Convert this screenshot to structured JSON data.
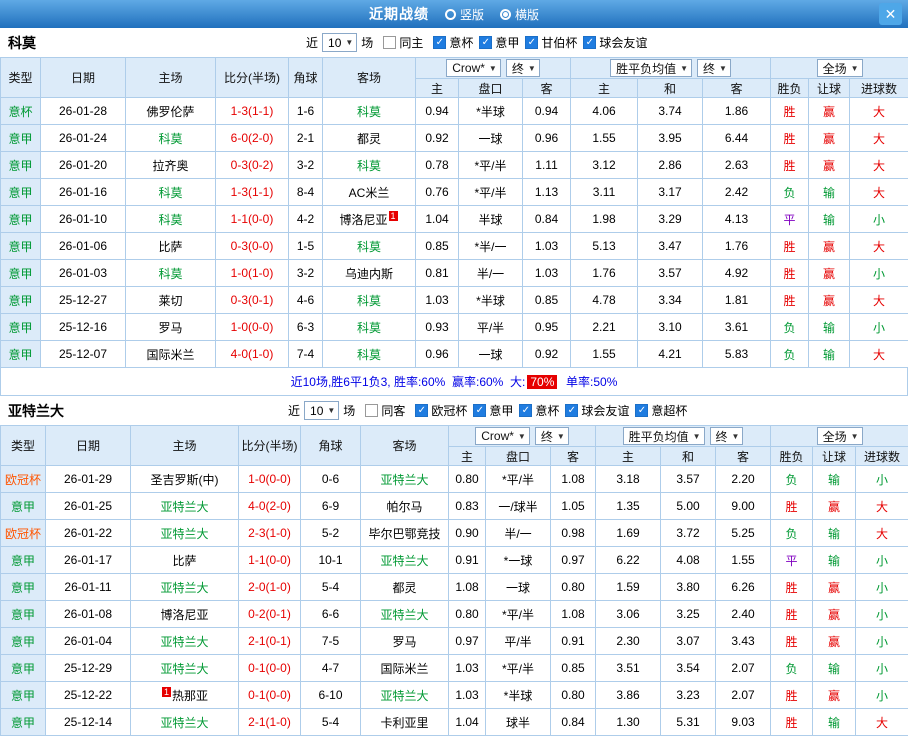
{
  "titlebar": {
    "title": "近期战绩",
    "radios": [
      {
        "label": "竖版",
        "selected": false
      },
      {
        "label": "横版",
        "selected": true
      }
    ],
    "close_label": "✕"
  },
  "colors": {
    "bar_blue_top": "#5fa9e5",
    "bar_blue_bottom": "#2070bd",
    "header_bg": "#dcebf9",
    "grid_line": "#aecdea",
    "win_red": "#e60000",
    "lose_green": "#009933",
    "draw_purple": "#8000c0",
    "league_orange": "#ff5500",
    "summary_blue": "#0000e6",
    "checkbox_blue": "#1f7ce0"
  },
  "value_colors": {
    "胜": "red",
    "平": "purple",
    "负": "green",
    "赢": "red",
    "输": "green",
    "大": "red",
    "小": "green"
  },
  "league_colors": {
    "意杯": "green",
    "意甲": "green",
    "欧冠杯": "orange",
    "甘伯杯": "green",
    "意超杯": "green"
  },
  "table_headers": {
    "type": "类型",
    "date": "日期",
    "home": "主场",
    "score": "比分(半场)",
    "corner": "角球",
    "away": "客场",
    "odds_home": "主",
    "handicap": "盘口",
    "odds_away": "客",
    "avg_home": "主",
    "avg_draw": "和",
    "avg_away": "客",
    "result_wdl": "胜负",
    "result_handicap": "让球",
    "result_goals": "进球数",
    "company_select": "Crow*",
    "final_select": "终",
    "avg_select": "胜平负均值",
    "scope_select": "全场"
  },
  "sections": [
    {
      "team": "科莫",
      "filters": {
        "near": "近",
        "count": "10",
        "unit": "场",
        "venue": {
          "label": "同主",
          "checked": false
        },
        "leagues": [
          {
            "label": "意杯",
            "checked": true
          },
          {
            "label": "意甲",
            "checked": true
          },
          {
            "label": "甘伯杯",
            "checked": true
          },
          {
            "label": "球会友谊",
            "checked": true
          }
        ]
      },
      "rows": [
        {
          "league": "意杯",
          "date": "26-01-28",
          "home": "佛罗伦萨",
          "score": "1-3(1-1)",
          "corner": "1-6",
          "away": "科莫",
          "odds": [
            "0.94",
            "*半球",
            "0.94"
          ],
          "avg": [
            "4.06",
            "3.74",
            "1.86"
          ],
          "results": [
            "胜",
            "赢",
            "大"
          ]
        },
        {
          "league": "意甲",
          "date": "26-01-24",
          "home": "科莫",
          "score": "6-0(2-0)",
          "corner": "2-1",
          "away": "都灵",
          "odds": [
            "0.92",
            "一球",
            "0.96"
          ],
          "avg": [
            "1.55",
            "3.95",
            "6.44"
          ],
          "results": [
            "胜",
            "赢",
            "大"
          ]
        },
        {
          "league": "意甲",
          "date": "26-01-20",
          "home": "拉齐奥",
          "score": "0-3(0-2)",
          "corner": "3-2",
          "away": "科莫",
          "odds": [
            "0.78",
            "*平/半",
            "1.11"
          ],
          "avg": [
            "3.12",
            "2.86",
            "2.63"
          ],
          "results": [
            "胜",
            "赢",
            "大"
          ]
        },
        {
          "league": "意甲",
          "date": "26-01-16",
          "home": "科莫",
          "score": "1-3(1-1)",
          "corner": "8-4",
          "away": "AC米兰",
          "odds": [
            "0.76",
            "*平/半",
            "1.13"
          ],
          "avg": [
            "3.11",
            "3.17",
            "2.42"
          ],
          "results": [
            "负",
            "输",
            "大"
          ]
        },
        {
          "league": "意甲",
          "date": "26-01-10",
          "home": "科莫",
          "score": "1-1(0-0)",
          "corner": "4-2",
          "away": "博洛尼亚",
          "away_badge": "1",
          "odds": [
            "1.04",
            "半球",
            "0.84"
          ],
          "avg": [
            "1.98",
            "3.29",
            "4.13"
          ],
          "results": [
            "平",
            "输",
            "小"
          ]
        },
        {
          "league": "意甲",
          "date": "26-01-06",
          "home": "比萨",
          "score": "0-3(0-0)",
          "corner": "1-5",
          "away": "科莫",
          "odds": [
            "0.85",
            "*半/一",
            "1.03"
          ],
          "avg": [
            "5.13",
            "3.47",
            "1.76"
          ],
          "results": [
            "胜",
            "赢",
            "大"
          ]
        },
        {
          "league": "意甲",
          "date": "26-01-03",
          "home": "科莫",
          "score": "1-0(1-0)",
          "corner": "3-2",
          "away": "乌迪内斯",
          "odds": [
            "0.81",
            "半/一",
            "1.03"
          ],
          "avg": [
            "1.76",
            "3.57",
            "4.92"
          ],
          "results": [
            "胜",
            "赢",
            "小"
          ]
        },
        {
          "league": "意甲",
          "date": "25-12-27",
          "home": "莱切",
          "score": "0-3(0-1)",
          "corner": "4-6",
          "away": "科莫",
          "odds": [
            "1.03",
            "*半球",
            "0.85"
          ],
          "avg": [
            "4.78",
            "3.34",
            "1.81"
          ],
          "results": [
            "胜",
            "赢",
            "大"
          ]
        },
        {
          "league": "意甲",
          "date": "25-12-16",
          "home": "罗马",
          "score": "1-0(0-0)",
          "corner": "6-3",
          "away": "科莫",
          "odds": [
            "0.93",
            "平/半",
            "0.95"
          ],
          "avg": [
            "2.21",
            "3.10",
            "3.61"
          ],
          "results": [
            "负",
            "输",
            "小"
          ]
        },
        {
          "league": "意甲",
          "date": "25-12-07",
          "home": "国际米兰",
          "score": "4-0(1-0)",
          "corner": "7-4",
          "away": "科莫",
          "odds": [
            "0.96",
            "一球",
            "0.92"
          ],
          "avg": [
            "1.55",
            "4.21",
            "5.83"
          ],
          "results": [
            "负",
            "输",
            "大"
          ]
        }
      ],
      "summary": {
        "pre": "近10场,胜6平1负3, 胜率:60%  赢率:60%  大:",
        "highlight": "70%",
        "post": "  单率:50%"
      }
    },
    {
      "team": "亚特兰大",
      "filters": {
        "near": "近",
        "count": "10",
        "unit": "场",
        "venue": {
          "label": "同客",
          "checked": false
        },
        "leagues": [
          {
            "label": "欧冠杯",
            "checked": true
          },
          {
            "label": "意甲",
            "checked": true
          },
          {
            "label": "意杯",
            "checked": true
          },
          {
            "label": "球会友谊",
            "checked": true
          },
          {
            "label": "意超杯",
            "checked": true
          }
        ]
      },
      "rows": [
        {
          "league": "欧冠杯",
          "date": "26-01-29",
          "home": "圣吉罗斯(中)",
          "score": "1-0(0-0)",
          "corner": "0-6",
          "away": "亚特兰大",
          "odds": [
            "0.80",
            "*平/半",
            "1.08"
          ],
          "avg": [
            "3.18",
            "3.57",
            "2.20"
          ],
          "results": [
            "负",
            "输",
            "小"
          ]
        },
        {
          "league": "意甲",
          "date": "26-01-25",
          "home": "亚特兰大",
          "score": "4-0(2-0)",
          "corner": "6-9",
          "away": "帕尔马",
          "odds": [
            "0.83",
            "一/球半",
            "1.05"
          ],
          "avg": [
            "1.35",
            "5.00",
            "9.00"
          ],
          "results": [
            "胜",
            "赢",
            "大"
          ]
        },
        {
          "league": "欧冠杯",
          "date": "26-01-22",
          "home": "亚特兰大",
          "score": "2-3(1-0)",
          "corner": "5-2",
          "away": "毕尔巴鄂竞技",
          "odds": [
            "0.90",
            "半/一",
            "0.98"
          ],
          "avg": [
            "1.69",
            "3.72",
            "5.25"
          ],
          "results": [
            "负",
            "输",
            "大"
          ]
        },
        {
          "league": "意甲",
          "date": "26-01-17",
          "home": "比萨",
          "score": "1-1(0-0)",
          "corner": "10-1",
          "away": "亚特兰大",
          "odds": [
            "0.91",
            "*一球",
            "0.97"
          ],
          "avg": [
            "6.22",
            "4.08",
            "1.55"
          ],
          "results": [
            "平",
            "输",
            "小"
          ]
        },
        {
          "league": "意甲",
          "date": "26-01-11",
          "home": "亚特兰大",
          "score": "2-0(1-0)",
          "corner": "5-4",
          "away": "都灵",
          "odds": [
            "1.08",
            "一球",
            "0.80"
          ],
          "avg": [
            "1.59",
            "3.80",
            "6.26"
          ],
          "results": [
            "胜",
            "赢",
            "小"
          ]
        },
        {
          "league": "意甲",
          "date": "26-01-08",
          "home": "博洛尼亚",
          "score": "0-2(0-1)",
          "corner": "6-6",
          "away": "亚特兰大",
          "odds": [
            "0.80",
            "*平/半",
            "1.08"
          ],
          "avg": [
            "3.06",
            "3.25",
            "2.40"
          ],
          "results": [
            "胜",
            "赢",
            "小"
          ]
        },
        {
          "league": "意甲",
          "date": "26-01-04",
          "home": "亚特兰大",
          "score": "2-1(0-1)",
          "corner": "7-5",
          "away": "罗马",
          "odds": [
            "0.97",
            "平/半",
            "0.91"
          ],
          "avg": [
            "2.30",
            "3.07",
            "3.43"
          ],
          "results": [
            "胜",
            "赢",
            "小"
          ]
        },
        {
          "league": "意甲",
          "date": "25-12-29",
          "home": "亚特兰大",
          "score": "0-1(0-0)",
          "corner": "4-7",
          "away": "国际米兰",
          "odds": [
            "1.03",
            "*平/半",
            "0.85"
          ],
          "avg": [
            "3.51",
            "3.54",
            "2.07"
          ],
          "results": [
            "负",
            "输",
            "小"
          ]
        },
        {
          "league": "意甲",
          "date": "25-12-22",
          "home": "热那亚",
          "home_badge": "1",
          "home_badge_side": "left",
          "score": "0-1(0-0)",
          "corner": "6-10",
          "away": "亚特兰大",
          "odds": [
            "1.03",
            "*半球",
            "0.80"
          ],
          "avg": [
            "3.86",
            "3.23",
            "2.07"
          ],
          "results": [
            "胜",
            "赢",
            "小"
          ]
        },
        {
          "league": "意甲",
          "date": "25-12-14",
          "home": "亚特兰大",
          "score": "2-1(1-0)",
          "corner": "5-4",
          "away": "卡利亚里",
          "odds": [
            "1.04",
            "球半",
            "0.84"
          ],
          "avg": [
            "1.30",
            "5.31",
            "9.03"
          ],
          "results": [
            "胜",
            "输",
            "大"
          ]
        }
      ]
    }
  ]
}
